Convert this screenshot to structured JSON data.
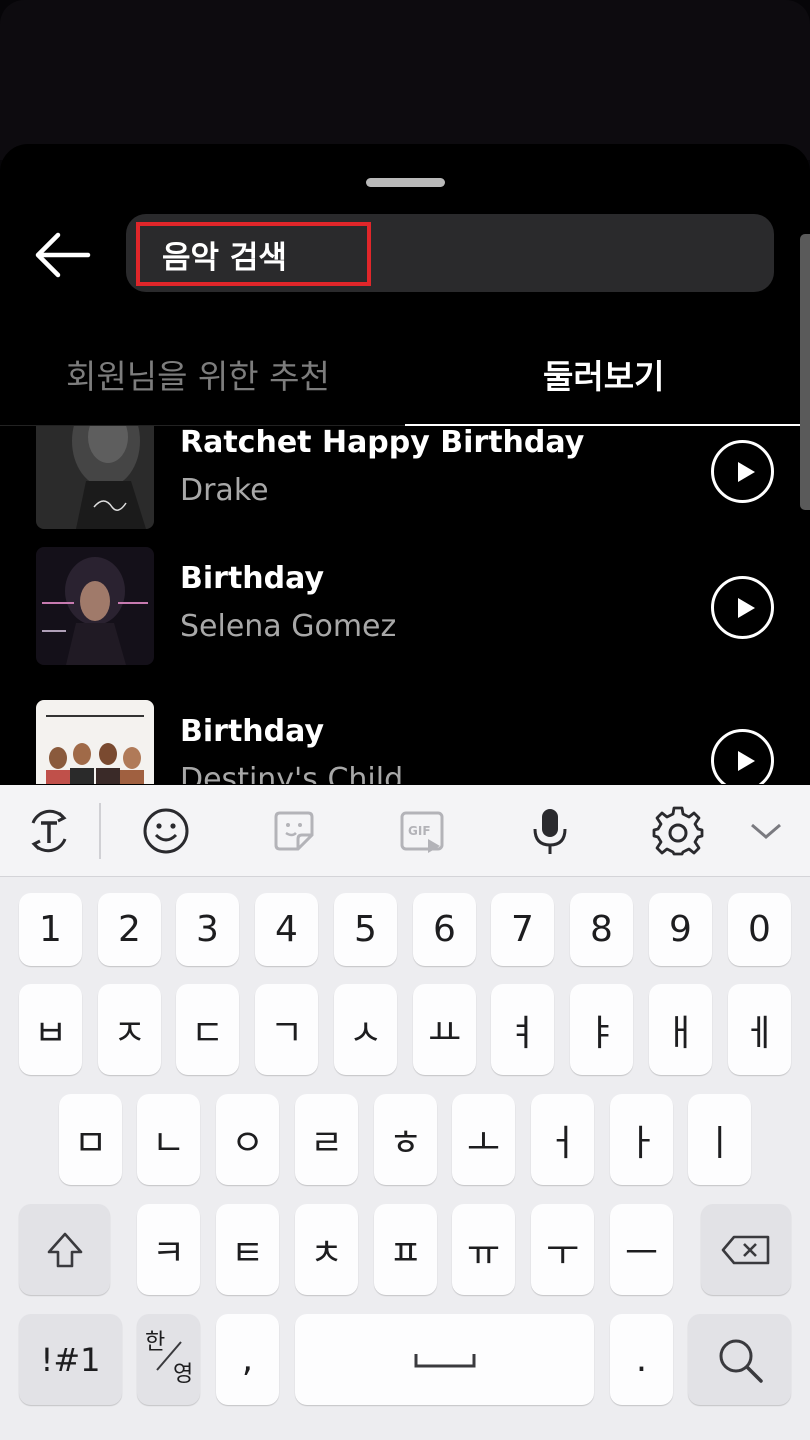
{
  "search": {
    "value": "음악 검색"
  },
  "tabs": [
    {
      "label": "회원님을 위한 추천",
      "selected": false
    },
    {
      "label": "둘러보기",
      "selected": true
    }
  ],
  "songs": [
    {
      "title": "Ratchet Happy Birthday",
      "artist": "Drake",
      "cover": "album-cover-dark"
    },
    {
      "title": "Birthday",
      "artist": "Selena Gomez",
      "cover": "album-cover-stars-dance"
    },
    {
      "title": "Birthday",
      "artist": "Destiny's Child",
      "cover": "album-cover-destinys-child"
    }
  ],
  "keyboard": {
    "toolbar": [
      "text-mode-icon",
      "emoji-icon",
      "sticker-icon",
      "gif-icon",
      "microphone-icon",
      "settings-icon",
      "chevron-down-icon"
    ],
    "rows": [
      [
        "1",
        "2",
        "3",
        "4",
        "5",
        "6",
        "7",
        "8",
        "9",
        "0"
      ],
      [
        "ㅂ",
        "ㅈ",
        "ㄷ",
        "ㄱ",
        "ㅅ",
        "ㅛ",
        "ㅕ",
        "ㅑ",
        "ㅐ",
        "ㅔ"
      ],
      [
        "ㅁ",
        "ㄴ",
        "ㅇ",
        "ㄹ",
        "ㅎ",
        "ㅗ",
        "ㅓ",
        "ㅏ",
        "ㅣ"
      ],
      [
        "ㅋ",
        "ㅌ",
        "ㅊ",
        "ㅍ",
        "ㅠ",
        "ㅜ",
        "ㅡ"
      ]
    ],
    "symbols_key": "!#1",
    "lang_key": {
      "primary": "한",
      "secondary": "영"
    },
    "comma_key": ",",
    "period_key": "."
  },
  "colors": {
    "highlight": "#e0262a",
    "background": "#000000",
    "keyboard": "#ededf0"
  }
}
